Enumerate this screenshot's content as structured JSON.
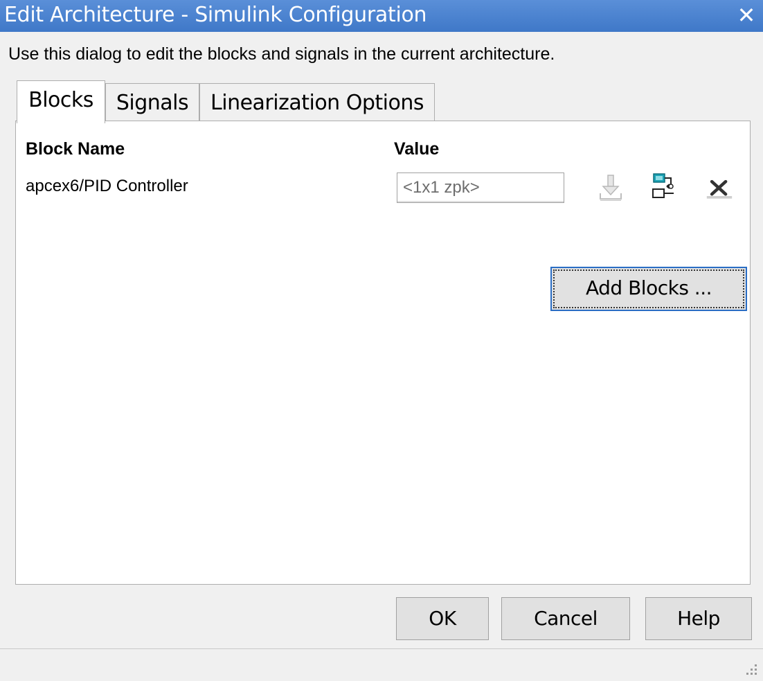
{
  "window": {
    "title": "Edit Architecture - Simulink Configuration",
    "close_glyph": "✕"
  },
  "description": "Use this dialog to edit the blocks and signals in the current architecture.",
  "tabs": [
    {
      "label": "Blocks",
      "active": true
    },
    {
      "label": "Signals",
      "active": false
    },
    {
      "label": "Linearization Options",
      "active": false
    }
  ],
  "table": {
    "headers": {
      "block_name": "Block Name",
      "value": "Value"
    },
    "rows": [
      {
        "block_name": "apcex6/PID Controller",
        "value": "<1x1 zpk>",
        "icons": [
          "import-icon",
          "block-diagram-icon",
          "delete-icon"
        ]
      }
    ]
  },
  "buttons": {
    "add_blocks": "Add Blocks ...",
    "ok": "OK",
    "cancel": "Cancel",
    "help": "Help"
  },
  "colors": {
    "titlebar": "#4f84cf",
    "focus_border": "#2a6dc4",
    "teal_icon": "#1ba2b5"
  }
}
